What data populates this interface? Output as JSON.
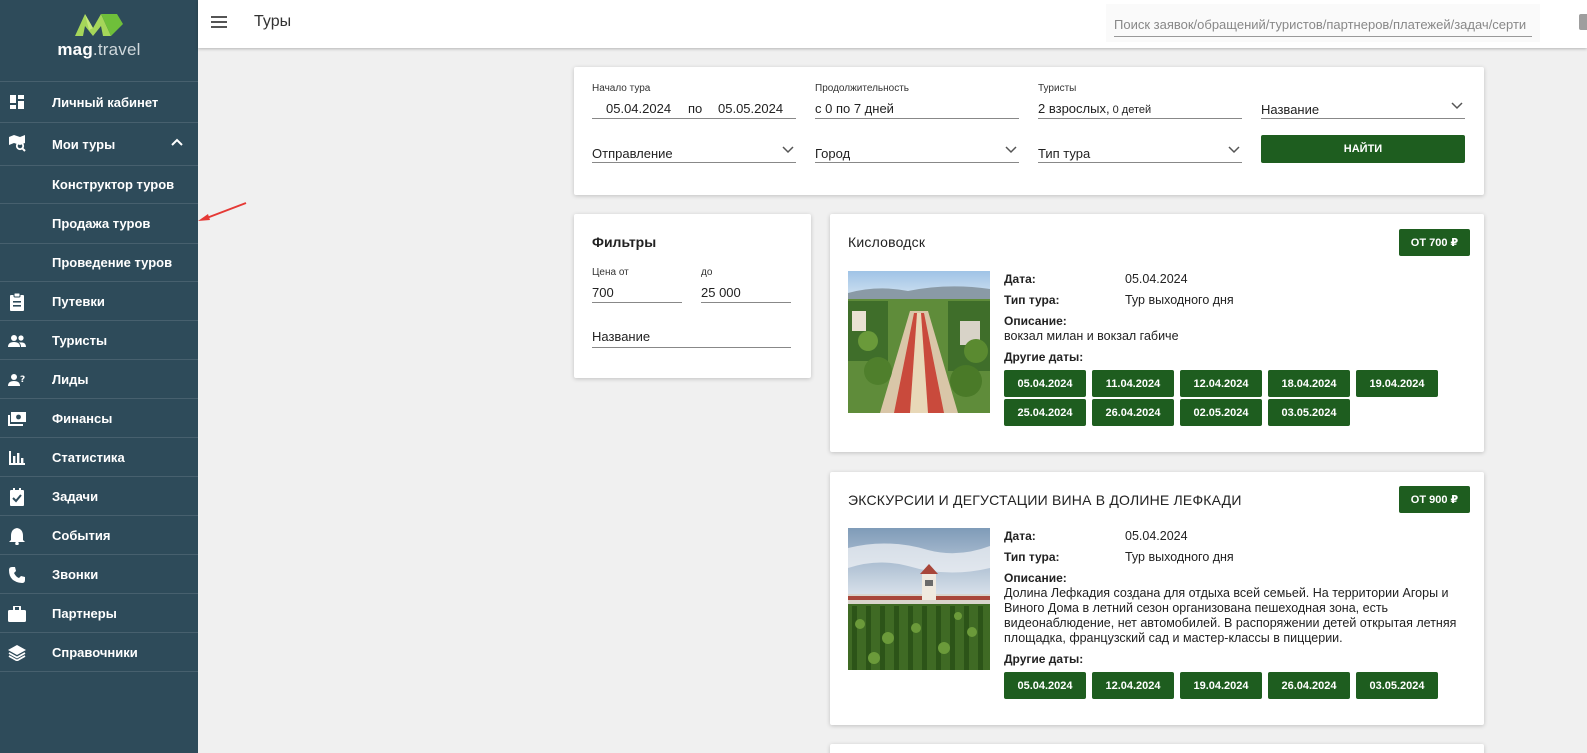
{
  "brand": {
    "name_bold": "mag",
    "name_light": ".travel"
  },
  "sidebar": {
    "items": [
      {
        "label": "Личный кабинет",
        "icon": "dashboard-icon"
      },
      {
        "label": "Мои туры",
        "icon": "map-search-icon",
        "expanded": true
      },
      {
        "label": "Конструктор туров",
        "sub": true
      },
      {
        "label": "Продажа туров",
        "sub": true
      },
      {
        "label": "Проведение туров",
        "sub": true
      },
      {
        "label": "Путевки",
        "icon": "clipboard-icon"
      },
      {
        "label": "Туристы",
        "icon": "people-icon"
      },
      {
        "label": "Лиды",
        "icon": "person-question-icon"
      },
      {
        "label": "Финансы",
        "icon": "money-icon"
      },
      {
        "label": "Статистика",
        "icon": "bar-chart-icon"
      },
      {
        "label": "Задачи",
        "icon": "task-check-icon"
      },
      {
        "label": "События",
        "icon": "bell-icon"
      },
      {
        "label": "Звонки",
        "icon": "phone-icon"
      },
      {
        "label": "Партнеры",
        "icon": "briefcase-icon"
      },
      {
        "label": "Справочники",
        "icon": "layers-icon"
      }
    ]
  },
  "topbar": {
    "title": "Туры",
    "search_placeholder": "Поиск заявок/обращений/туристов/партнеров/платежей/задач/серти"
  },
  "search_form": {
    "start_label": "Начало тура",
    "date_from": "05.04.2024",
    "date_sep": "по",
    "date_to": "05.05.2024",
    "duration_label": "Продолжительность",
    "duration_value": "с 0 по 7 дней",
    "tourists_label": "Туристы",
    "tourists_adults": "2 взрослых,",
    "tourists_children": " 0 детей",
    "name_select": "Название",
    "departure_select": "Отправление",
    "city_select": "Город",
    "type_select": "Тип тура",
    "find_button": "НАЙТИ"
  },
  "filters": {
    "title": "Фильтры",
    "price_from_label": "Цена от",
    "price_from": "700",
    "price_to_label": "до",
    "price_to": "25 000",
    "name_label": "Название"
  },
  "labels": {
    "date": "Дата:",
    "type": "Тип тура:",
    "description": "Описание:",
    "other_dates": "Другие даты:"
  },
  "tours": [
    {
      "title": "Кисловодск",
      "price": "ОТ 700 ₽",
      "date": "05.04.2024",
      "type": "Тур выходного дня",
      "description": "вокзал милан и вокзал габиче",
      "dates": [
        "05.04.2024",
        "11.04.2024",
        "12.04.2024",
        "18.04.2024",
        "19.04.2024",
        "25.04.2024",
        "26.04.2024",
        "02.05.2024",
        "03.05.2024"
      ]
    },
    {
      "title": "ЭКСКУРСИИ И ДЕГУСТАЦИИ ВИНА В ДОЛИНЕ ЛЕФКАДИ",
      "price": "ОТ 900 ₽",
      "date": "05.04.2024",
      "type": "Тур выходного дня",
      "description": "Долина Лефкадия создана для отдыха всей семьей. На территории Агоры и Виного Дома в летний сезон организована пешеходная зона, есть видеонаблюдение, нет автомобилей. В распоряжении детей открытая летняя площадка, французский сад и мастер-классы в пиццерии.",
      "dates": [
        "05.04.2024",
        "12.04.2024",
        "19.04.2024",
        "26.04.2024",
        "03.05.2024"
      ]
    }
  ],
  "colors": {
    "sidebar": "#2e4b5a",
    "accent": "#1e5d1f",
    "logo_green": "#8bc34a"
  }
}
